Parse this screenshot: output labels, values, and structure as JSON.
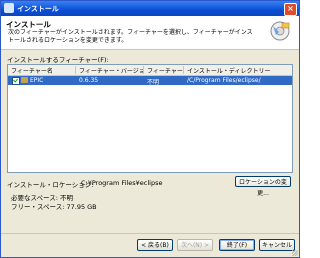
{
  "window": {
    "title": "インストール",
    "close_label": "×"
  },
  "banner": {
    "title": "インストール",
    "description": "次のフィーチャーがインストールされます。フィーチャーを選択し、フィーチャーがインストールされるロケーションを変更できます。"
  },
  "features": {
    "section_label": "インストールするフィーチャー(F):",
    "columns": [
      "フィーチャー名",
      "フィーチャー・バージョン",
      "フィーチャー...",
      "インストール・ディレクトリー"
    ],
    "rows": [
      {
        "name": "EPIC",
        "version": "0.6.35",
        "size": "不明",
        "directory": "/C/Program Files/eclipse/"
      }
    ]
  },
  "location": {
    "label": "インストール・ロケーション:",
    "value": "C:¥Program Files¥eclipse",
    "change_button": "ロケーションの変更..."
  },
  "space": {
    "required": "必要なスペース: 不明",
    "free": "フリー・スペース: 77.95 GB"
  },
  "buttons": {
    "back": "< 戻る(B)",
    "next": "次へ(N) >",
    "finish": "終了(F)",
    "cancel": "キャンセル"
  }
}
